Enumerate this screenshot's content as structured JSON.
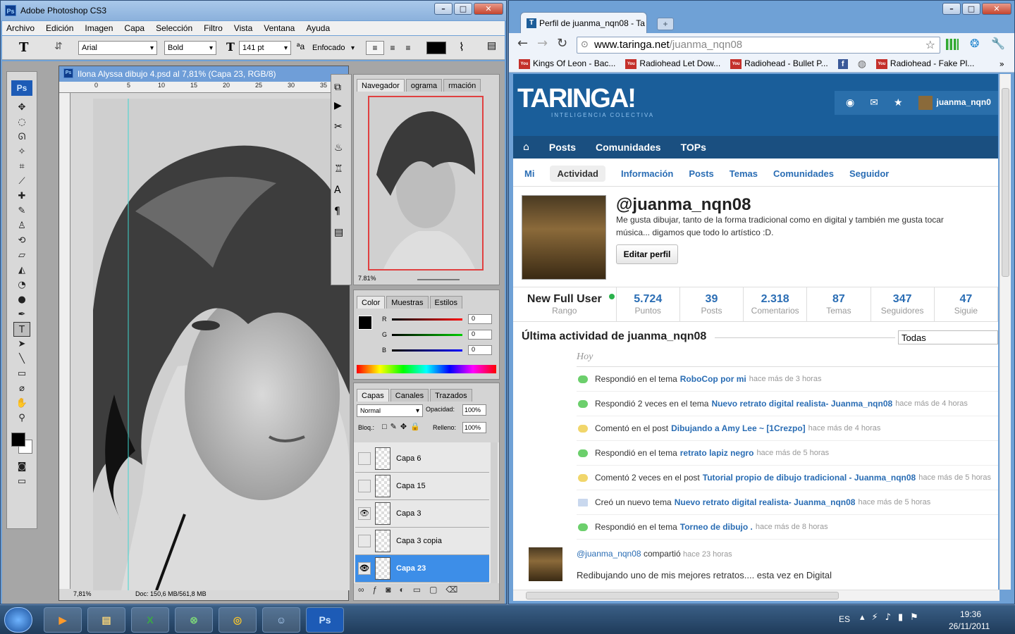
{
  "photoshop": {
    "title": "Adobe Photoshop CS3",
    "menu": [
      "Archivo",
      "Edición",
      "Imagen",
      "Capa",
      "Selección",
      "Filtro",
      "Vista",
      "Ventana",
      "Ayuda"
    ],
    "options": {
      "font_family": "Arial",
      "font_style": "Bold",
      "font_size": "141 pt",
      "antialias": "Enfocado"
    },
    "document": {
      "title": "Ilona Alyssa dibujo 4.psd al 7,81% (Capa 23, RGB/8)",
      "ruler_ticks": [
        "0",
        "5",
        "10",
        "15",
        "20",
        "25",
        "30",
        "35"
      ],
      "status_zoom": "7,81%",
      "status_doc": "Doc: 150,6 MB/561,8 MB"
    },
    "navigator": {
      "tabs": [
        "Navegador",
        "ograma",
        "rmación"
      ],
      "zoom": "7.81%"
    },
    "color_panel": {
      "tabs": [
        "Color",
        "Muestras",
        "Estilos"
      ],
      "channels": [
        {
          "label": "R",
          "value": "0"
        },
        {
          "label": "G",
          "value": "0"
        },
        {
          "label": "B",
          "value": "0"
        }
      ]
    },
    "layers_panel": {
      "tabs": [
        "Capas",
        "Canales",
        "Trazados"
      ],
      "blend_mode": "Normal",
      "opacity_label": "Opacidad:",
      "opacity": "100%",
      "lock_label": "Bloq.:",
      "fill_label": "Relleno:",
      "fill": "100%",
      "layers": [
        {
          "name": "Capa 6",
          "visible": false,
          "active": false
        },
        {
          "name": "Capa 15",
          "visible": false,
          "active": false
        },
        {
          "name": "Capa 3",
          "visible": true,
          "active": false
        },
        {
          "name": "Capa 3 copia",
          "visible": false,
          "active": false
        },
        {
          "name": "Capa 23",
          "visible": true,
          "active": true
        }
      ]
    }
  },
  "chrome": {
    "tab_title": "Perfil de juanma_nqn08 - Ta",
    "url_host": "www.taringa.net",
    "url_path": "/juanma_nqn08",
    "bookmarks": [
      "Kings Of Leon - Bac...",
      "Radiohead Let Dow...",
      "Radiohead - Bullet P...",
      "Radiohead - Fake Pl..."
    ],
    "site": {
      "logo": "TARINGA!",
      "tagline": "INTELIGENCIA COLECTIVA",
      "user": "juanma_nqn0",
      "nav": [
        "Posts",
        "Comunidades",
        "TOPs"
      ],
      "subnav": [
        "Mi",
        "Actividad",
        "Información",
        "Posts",
        "Temas",
        "Comunidades",
        "Seguidor"
      ],
      "profile": {
        "handle": "@juanma_nqn08",
        "bio": "Me gusta dibujar, tanto de la forma tradicional como en digital y también me gusta tocar música... digamos que todo lo artístico :D.",
        "edit_button": "Editar perfil"
      },
      "stats": [
        {
          "n": "New Full User",
          "l": "Rango"
        },
        {
          "n": "5.724",
          "l": "Puntos"
        },
        {
          "n": "39",
          "l": "Posts"
        },
        {
          "n": "2.318",
          "l": "Comentarios"
        },
        {
          "n": "87",
          "l": "Temas"
        },
        {
          "n": "347",
          "l": "Seguidores"
        },
        {
          "n": "47",
          "l": "Siguie"
        }
      ],
      "activity_title": "Última actividad de juanma_nqn08",
      "filter": "Todas",
      "today": "Hoy",
      "activity": [
        {
          "pre": "Respondió en el tema",
          "link": "RoboCop por mi",
          "time": "hace más de 3 horas",
          "icon": "green"
        },
        {
          "pre": "Respondió 2 veces en el tema",
          "link": "Nuevo retrato digital realista- Juanma_nqn08",
          "time": "hace más de 4 horas",
          "icon": "green"
        },
        {
          "pre": "Comentó en el post",
          "link": "Dibujando a Amy Lee ~ [1Crezpo]",
          "time": "hace más de 4 horas",
          "icon": "yellow"
        },
        {
          "pre": "Respondió en el tema",
          "link": "retrato lapiz negro",
          "time": "hace más de 5 horas",
          "icon": "green"
        },
        {
          "pre": "Comentó 2 veces en el post",
          "link": "Tutorial propio de dibujo tradicional - Juanma_nqn08",
          "time": "hace más de 5 horas",
          "icon": "yellow"
        },
        {
          "pre": "Creó un nuevo tema",
          "link": "Nuevo retrato digital realista- Juanma_nqn08",
          "time": "hace más de 5 horas",
          "icon": "doc"
        },
        {
          "pre": "Respondió en el tema",
          "link": "Torneo de dibujo .",
          "time": "hace más de 8 horas",
          "icon": "green"
        }
      ],
      "post": {
        "user": "@juanma_nqn08",
        "verb": "compartió",
        "time": "hace 23 horas",
        "text": "Redibujando uno de mis mejores retratos.... esta vez en Digital"
      }
    }
  },
  "taskbar": {
    "lang": "ES",
    "time": "19:36",
    "date": "26/11/2011"
  }
}
